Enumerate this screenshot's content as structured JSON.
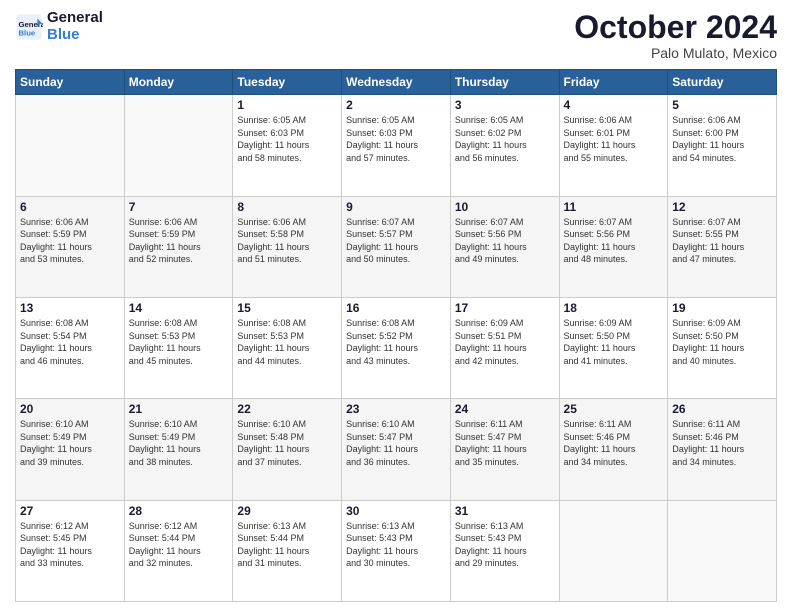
{
  "header": {
    "logo_line1": "General",
    "logo_line2": "Blue",
    "month": "October 2024",
    "location": "Palo Mulato, Mexico"
  },
  "days_of_week": [
    "Sunday",
    "Monday",
    "Tuesday",
    "Wednesday",
    "Thursday",
    "Friday",
    "Saturday"
  ],
  "weeks": [
    [
      {
        "day": "",
        "info": ""
      },
      {
        "day": "",
        "info": ""
      },
      {
        "day": "1",
        "info": "Sunrise: 6:05 AM\nSunset: 6:03 PM\nDaylight: 11 hours\nand 58 minutes."
      },
      {
        "day": "2",
        "info": "Sunrise: 6:05 AM\nSunset: 6:03 PM\nDaylight: 11 hours\nand 57 minutes."
      },
      {
        "day": "3",
        "info": "Sunrise: 6:05 AM\nSunset: 6:02 PM\nDaylight: 11 hours\nand 56 minutes."
      },
      {
        "day": "4",
        "info": "Sunrise: 6:06 AM\nSunset: 6:01 PM\nDaylight: 11 hours\nand 55 minutes."
      },
      {
        "day": "5",
        "info": "Sunrise: 6:06 AM\nSunset: 6:00 PM\nDaylight: 11 hours\nand 54 minutes."
      }
    ],
    [
      {
        "day": "6",
        "info": "Sunrise: 6:06 AM\nSunset: 5:59 PM\nDaylight: 11 hours\nand 53 minutes."
      },
      {
        "day": "7",
        "info": "Sunrise: 6:06 AM\nSunset: 5:59 PM\nDaylight: 11 hours\nand 52 minutes."
      },
      {
        "day": "8",
        "info": "Sunrise: 6:06 AM\nSunset: 5:58 PM\nDaylight: 11 hours\nand 51 minutes."
      },
      {
        "day": "9",
        "info": "Sunrise: 6:07 AM\nSunset: 5:57 PM\nDaylight: 11 hours\nand 50 minutes."
      },
      {
        "day": "10",
        "info": "Sunrise: 6:07 AM\nSunset: 5:56 PM\nDaylight: 11 hours\nand 49 minutes."
      },
      {
        "day": "11",
        "info": "Sunrise: 6:07 AM\nSunset: 5:56 PM\nDaylight: 11 hours\nand 48 minutes."
      },
      {
        "day": "12",
        "info": "Sunrise: 6:07 AM\nSunset: 5:55 PM\nDaylight: 11 hours\nand 47 minutes."
      }
    ],
    [
      {
        "day": "13",
        "info": "Sunrise: 6:08 AM\nSunset: 5:54 PM\nDaylight: 11 hours\nand 46 minutes."
      },
      {
        "day": "14",
        "info": "Sunrise: 6:08 AM\nSunset: 5:53 PM\nDaylight: 11 hours\nand 45 minutes."
      },
      {
        "day": "15",
        "info": "Sunrise: 6:08 AM\nSunset: 5:53 PM\nDaylight: 11 hours\nand 44 minutes."
      },
      {
        "day": "16",
        "info": "Sunrise: 6:08 AM\nSunset: 5:52 PM\nDaylight: 11 hours\nand 43 minutes."
      },
      {
        "day": "17",
        "info": "Sunrise: 6:09 AM\nSunset: 5:51 PM\nDaylight: 11 hours\nand 42 minutes."
      },
      {
        "day": "18",
        "info": "Sunrise: 6:09 AM\nSunset: 5:50 PM\nDaylight: 11 hours\nand 41 minutes."
      },
      {
        "day": "19",
        "info": "Sunrise: 6:09 AM\nSunset: 5:50 PM\nDaylight: 11 hours\nand 40 minutes."
      }
    ],
    [
      {
        "day": "20",
        "info": "Sunrise: 6:10 AM\nSunset: 5:49 PM\nDaylight: 11 hours\nand 39 minutes."
      },
      {
        "day": "21",
        "info": "Sunrise: 6:10 AM\nSunset: 5:49 PM\nDaylight: 11 hours\nand 38 minutes."
      },
      {
        "day": "22",
        "info": "Sunrise: 6:10 AM\nSunset: 5:48 PM\nDaylight: 11 hours\nand 37 minutes."
      },
      {
        "day": "23",
        "info": "Sunrise: 6:10 AM\nSunset: 5:47 PM\nDaylight: 11 hours\nand 36 minutes."
      },
      {
        "day": "24",
        "info": "Sunrise: 6:11 AM\nSunset: 5:47 PM\nDaylight: 11 hours\nand 35 minutes."
      },
      {
        "day": "25",
        "info": "Sunrise: 6:11 AM\nSunset: 5:46 PM\nDaylight: 11 hours\nand 34 minutes."
      },
      {
        "day": "26",
        "info": "Sunrise: 6:11 AM\nSunset: 5:46 PM\nDaylight: 11 hours\nand 34 minutes."
      }
    ],
    [
      {
        "day": "27",
        "info": "Sunrise: 6:12 AM\nSunset: 5:45 PM\nDaylight: 11 hours\nand 33 minutes."
      },
      {
        "day": "28",
        "info": "Sunrise: 6:12 AM\nSunset: 5:44 PM\nDaylight: 11 hours\nand 32 minutes."
      },
      {
        "day": "29",
        "info": "Sunrise: 6:13 AM\nSunset: 5:44 PM\nDaylight: 11 hours\nand 31 minutes."
      },
      {
        "day": "30",
        "info": "Sunrise: 6:13 AM\nSunset: 5:43 PM\nDaylight: 11 hours\nand 30 minutes."
      },
      {
        "day": "31",
        "info": "Sunrise: 6:13 AM\nSunset: 5:43 PM\nDaylight: 11 hours\nand 29 minutes."
      },
      {
        "day": "",
        "info": ""
      },
      {
        "day": "",
        "info": ""
      }
    ]
  ]
}
